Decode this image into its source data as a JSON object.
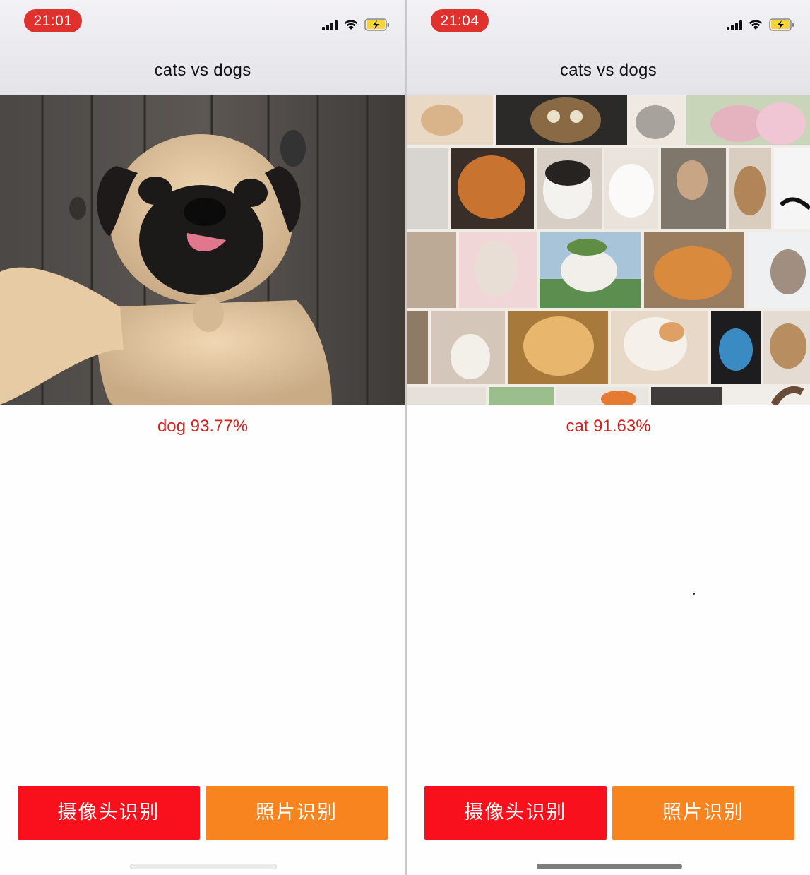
{
  "screens": [
    {
      "time": "21:01",
      "title": "cats vs dogs",
      "result": "dog 93.77%",
      "image": "pug-dog-selfie-photo",
      "buttons": {
        "camera": "摄像头识别",
        "photo": "照片识别"
      }
    },
    {
      "time": "21:04",
      "title": "cats vs dogs",
      "result": "cat 91.63%",
      "image": "cat-photo-collage",
      "buttons": {
        "camera": "摄像头识别",
        "photo": "照片识别"
      }
    }
  ],
  "icons": [
    "cellular-signal-icon",
    "wifi-icon",
    "battery-charging-icon"
  ],
  "colors": {
    "result_text": "#d0231e",
    "camera_button": "#f8111c",
    "photo_button": "#f8841f",
    "time_pill": "#e0312c"
  }
}
